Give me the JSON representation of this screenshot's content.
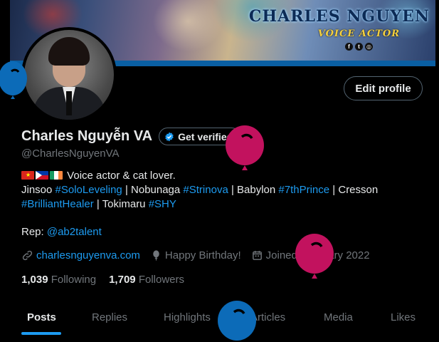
{
  "banner": {
    "title": "CHARLES NGUYEN",
    "subtitle": "VOICE ACTOR",
    "social_icons": [
      "facebook-icon",
      "twitter-icon",
      "instagram-icon"
    ]
  },
  "profile": {
    "edit_label": "Edit profile",
    "display_name": "Charles Nguyễn VA",
    "get_verified_label": "Get verified",
    "handle": "@CharlesNguyenVA",
    "bio": {
      "flags": [
        "vietnam-flag",
        "philippines-flag",
        "ireland-flag"
      ],
      "line1_text": "Voice actor & cat lover.",
      "line2": [
        {
          "text": "Jinsoo ",
          "tag": false
        },
        {
          "text": "#SoloLeveling",
          "tag": true
        },
        {
          "text": " | Nobunaga ",
          "tag": false
        },
        {
          "text": "#Strinova",
          "tag": true
        },
        {
          "text": " | Babylon ",
          "tag": false
        },
        {
          "text": "#7thPrince",
          "tag": true
        },
        {
          "text": " | Cresson",
          "tag": false
        }
      ],
      "line3": [
        {
          "text": "#BrilliantHealer",
          "tag": true
        },
        {
          "text": " | Tokimaru ",
          "tag": false
        },
        {
          "text": "#SHY",
          "tag": true
        }
      ],
      "rep_label": "Rep: ",
      "rep_handle": "@ab2talent"
    },
    "website": "charlesnguyenva.com",
    "birthday": "Happy Birthday!",
    "joined": "Joined February 2022",
    "following_count": "1,039",
    "following_label": "Following",
    "followers_count": "1,709",
    "followers_label": "Followers"
  },
  "tabs": [
    {
      "label": "Posts",
      "active": true
    },
    {
      "label": "Replies",
      "active": false
    },
    {
      "label": "Highlights",
      "active": false
    },
    {
      "label": "Articles",
      "active": false
    },
    {
      "label": "Media",
      "active": false
    },
    {
      "label": "Likes",
      "active": false
    }
  ],
  "colors": {
    "background": "#000000",
    "accent": "#1d9bf0",
    "muted": "#71767b",
    "balloon_pink": "#c2125e",
    "balloon_blue": "#0c6bb8"
  }
}
